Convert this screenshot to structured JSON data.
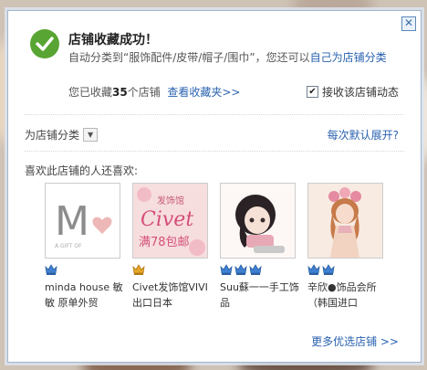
{
  "dialog": {
    "title": "店铺收藏成功！",
    "desc_prefix": "自动分类到“服饰配件/皮带/帽子/围巾”，您还可以",
    "desc_link": "自己为店铺分类",
    "count_prefix": "您已收藏",
    "count_value": "35",
    "count_suffix": "个店铺",
    "view_favorites": "查看收藏夹>>",
    "subscribe_label": "接收该店铺动态",
    "subscribe_checked": true,
    "close_symbol": "✕"
  },
  "category": {
    "label": "为店铺分类",
    "dropdown_symbol": "▼",
    "expand_link": "每次默认展开?"
  },
  "recommend": {
    "heading": "喜欢此店铺的人还喜欢:",
    "shops": [
      {
        "name": "minda house 敏敏 原单外贸",
        "badge": "blue",
        "badge_count": 1,
        "thumb_text": "M",
        "thumb_sub": "A GIFT OF"
      },
      {
        "name": "Civet发饰馆VIVI出口日本",
        "badge": "gold",
        "badge_count": 1,
        "thumb_text": "Civet",
        "thumb_top": "发饰馆",
        "thumb_bottom": "满78包邮"
      },
      {
        "name": "Suu蘇一一手工饰品",
        "badge": "blue",
        "badge_count": 3
      },
      {
        "name": "辛欣●饰品会所（韩国进口",
        "badge": "blue",
        "badge_count": 2
      }
    ],
    "more_link": "更多优选店铺 >>"
  },
  "colors": {
    "accent_link": "#2a62b0",
    "success_green": "#58a533",
    "crown_blue": "#3f7fd0",
    "crown_gold": "#d99a1c"
  }
}
